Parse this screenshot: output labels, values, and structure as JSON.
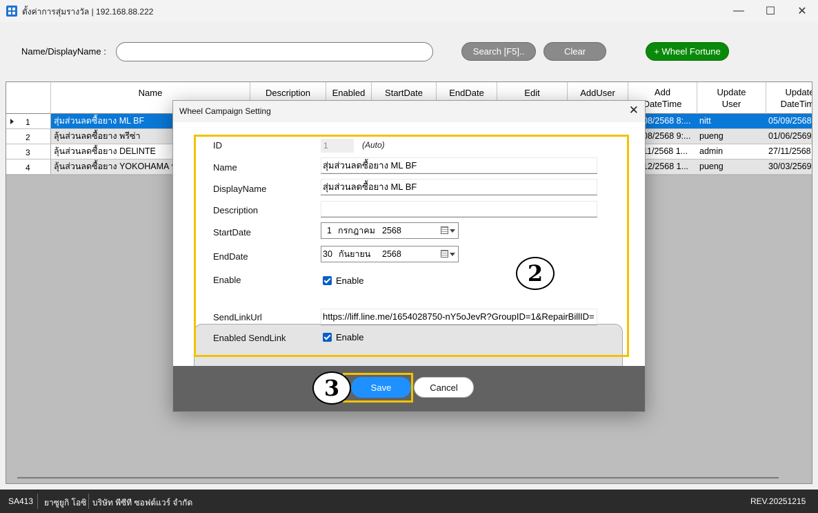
{
  "window": {
    "title": "ตั้งค่าการสุ่มรางวัล | 192.168.88.222",
    "minimize_glyph": "—",
    "maximize_glyph": "☐",
    "close_glyph": "✕"
  },
  "search": {
    "label": "Name/DisplayName :",
    "value": "",
    "search_button": "Search [F5]..",
    "clear_button": "Clear",
    "add_button": "+ Wheel Fortune"
  },
  "grid": {
    "headers": {
      "name": "Name",
      "description": "Description",
      "enabled": "Enabled",
      "startdate": "StartDate",
      "enddate": "EndDate",
      "edit": "Edit",
      "adduser": "AddUser",
      "add_datetime_1": "Add",
      "add_datetime_2": "DateTime",
      "update_user_1": "Update",
      "update_user_2": "User",
      "update_datetime_1": "Update",
      "update_datetime_2": "DateTime"
    },
    "rows": [
      {
        "num": "1",
        "name": "สุ่มส่วนลดซื้อยาง ML BF",
        "add_datetime": "08/2568 8:...",
        "update_user": "nitt",
        "update_datetime": "05/09/2568"
      },
      {
        "num": "2",
        "name": "ลุ้นส่วนลดซื้อยาง พรีซ่า",
        "add_datetime": "08/2568 9:...",
        "update_user": "pueng",
        "update_datetime": "01/06/2569"
      },
      {
        "num": "3",
        "name": "ลุ้นส่วนลดซื้อยาง DELINTE",
        "add_datetime": "11/2568 1...",
        "update_user": "admin",
        "update_datetime": "27/11/2568"
      },
      {
        "num": "4",
        "name": "ลุ้นส่วนลดซื้อยาง YOKOHAMA  ห",
        "add_datetime": "12/2568 1...",
        "update_user": "pueng",
        "update_datetime": "30/03/2569"
      }
    ]
  },
  "dialog": {
    "title": "Wheel Campaign Setting",
    "close_glyph": "✕",
    "id_label": "ID",
    "id_value": "1",
    "id_auto": "(Auto)",
    "name_label": "Name",
    "name_value": "สุ่มส่วนลดซื้อยาง ML BF",
    "displayname_label": "DisplayName",
    "displayname_value": "สุ่มส่วนลดซื้อยาง ML BF",
    "description_label": "Description",
    "description_value": "",
    "startdate_label": "StartDate",
    "startdate": {
      "day": "1",
      "month": "กรกฎาคม",
      "year": "2568"
    },
    "enddate_label": "EndDate",
    "enddate": {
      "day": "30",
      "month": "กันยายน",
      "year": "2568"
    },
    "enable_label": "Enable",
    "enable_checkbox_label": "Enable",
    "enable_checked": true,
    "sendlinkurl_label": "SendLinkUrl",
    "sendlinkurl_value": "https://liff.line.me/1654028750-nY5oJevR?GroupID=1&RepairBillID=",
    "enabled_sendlink_label": "Enabled SendLink",
    "enabled_sendlink_checkbox_label": "Enable",
    "enabled_sendlink_checked": true,
    "save_button": "Save",
    "cancel_button": "Cancel"
  },
  "annotations": {
    "badge_2": "2",
    "badge_3": "3",
    "highlight_color": "#f2c200"
  },
  "statusbar": {
    "code": "SA413",
    "user": "ยาซูยูกิ  โอซิ",
    "company": "บริษัท พีซีที ซอฟต์แวร์ จำกัด",
    "revision": "REV.20251215"
  },
  "colors": {
    "selection": "#0a78d7",
    "save_button": "#1e90ff",
    "wheel_button": "#0a8a0a",
    "statusbar": "#2b2b2b"
  }
}
